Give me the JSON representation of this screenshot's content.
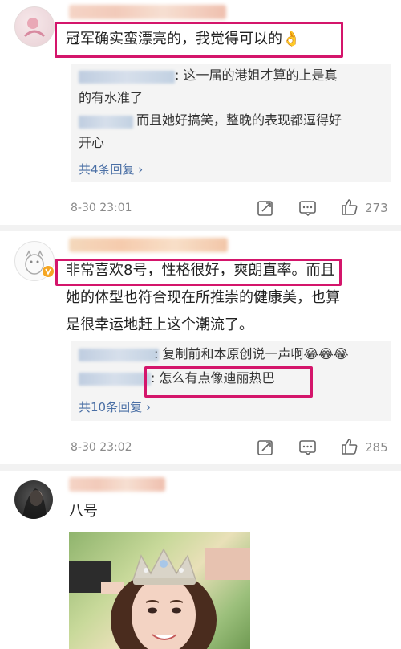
{
  "comments": [
    {
      "text_line1": "冠军确实蛮漂亮的，我觉得可以的",
      "emoji": "👌",
      "replies": [
        {
          "text": ": 这一届的港姐才算的上是真"
        },
        {
          "text": "的有水准了"
        },
        {
          "text": "而且她好搞笑，整晚的表现都逗得好"
        },
        {
          "text": "开心"
        }
      ],
      "more_replies": "共4条回复 ›",
      "time": "8-30 23:01",
      "likes": "273"
    },
    {
      "text_line1": "非常喜欢8号，性格很好，爽朗直率",
      "text_line1_tail": "。而且",
      "text_line2": "她的体型也符合现在所推崇的健康美，也算",
      "text_line3": "是很幸运地赶上这个潮流了。",
      "replies": [
        {
          "text": ": 复制前和本原创说一声啊",
          "emoji": "😂😂😂"
        },
        {
          "text": ": 怎么有点像迪丽热巴"
        }
      ],
      "more_replies": "共10条回复 ›",
      "time": "8-30 23:02",
      "likes": "285"
    },
    {
      "text_line1": "八号"
    }
  ],
  "icons": {
    "share": "share-icon",
    "comment": "comment-icon",
    "like": "thumbs-up-icon",
    "verified": "verified-badge-icon"
  },
  "colors": {
    "highlight": "#d4156b",
    "link": "#4a6fa5",
    "verified": "#f5a623"
  }
}
